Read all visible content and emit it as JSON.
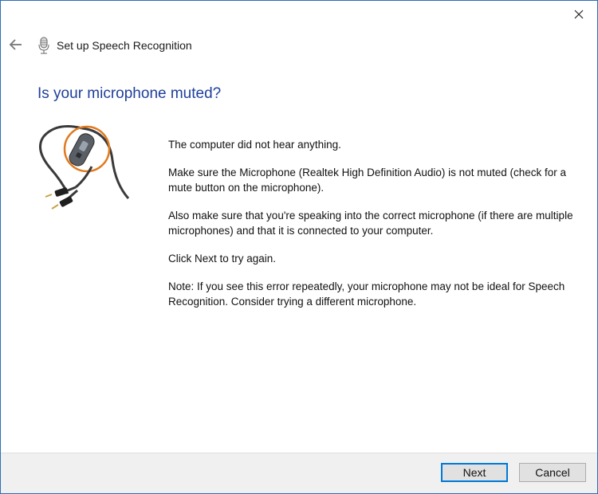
{
  "window": {
    "title": "Set up Speech Recognition"
  },
  "icons": {
    "back": "back-arrow-icon",
    "wizard": "microphone-icon",
    "close": "close-icon",
    "illustration": "headset-cable-mute-switch"
  },
  "page": {
    "heading": "Is your microphone muted?",
    "paragraphs": [
      "The computer did not hear anything.",
      "Make sure the Microphone (Realtek High Definition Audio) is not muted (check for a mute button on the microphone).",
      "Also make sure that you're speaking into the correct microphone (if there are multiple microphones) and that it is connected to your computer.",
      "Click Next to try again.",
      "Note: If you see this error repeatedly, your microphone may not be ideal for Speech Recognition. Consider trying a different microphone."
    ]
  },
  "buttons": {
    "next": "Next",
    "cancel": "Cancel"
  },
  "colors": {
    "heading": "#1e3f9a",
    "accent": "#0078d7",
    "highlight_ring": "#e07a1f"
  }
}
